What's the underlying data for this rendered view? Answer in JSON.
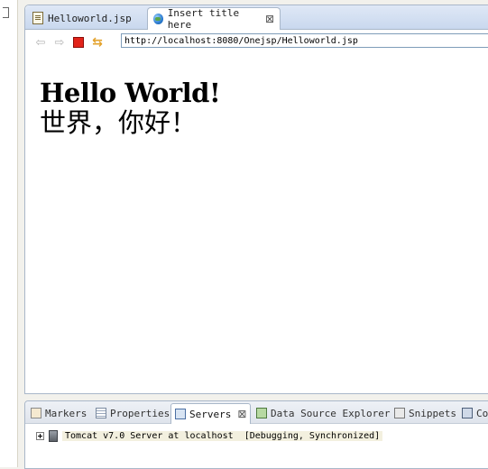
{
  "editor": {
    "tabs": [
      {
        "label": "Helloworld.jsp",
        "icon": "jsp-file-icon",
        "active": false
      },
      {
        "label": "Insert title here",
        "icon": "globe-icon",
        "active": true
      }
    ],
    "browser": {
      "url": "http://localhost:8080/Onejsp/Helloworld.jsp"
    },
    "page": {
      "heading": "Hello World!",
      "chinese": "世界，你好！"
    }
  },
  "panel": {
    "tabs": [
      {
        "label": "Markers",
        "icon": "markers-icon"
      },
      {
        "label": "Properties",
        "icon": "properties-icon"
      },
      {
        "label": "Servers",
        "icon": "servers-icon",
        "active": true
      },
      {
        "label": "Data Source Explorer",
        "icon": "data-source-icon"
      },
      {
        "label": "Snippets",
        "icon": "snippets-icon"
      },
      {
        "label": "Co",
        "icon": "console-icon"
      }
    ],
    "server": {
      "name": "Tomcat v7.0 Server at localhost",
      "status": "[Debugging, Synchronized]"
    }
  },
  "colors": {
    "stop": "#e2231a",
    "tab_gradient": "#dfe8f6"
  }
}
